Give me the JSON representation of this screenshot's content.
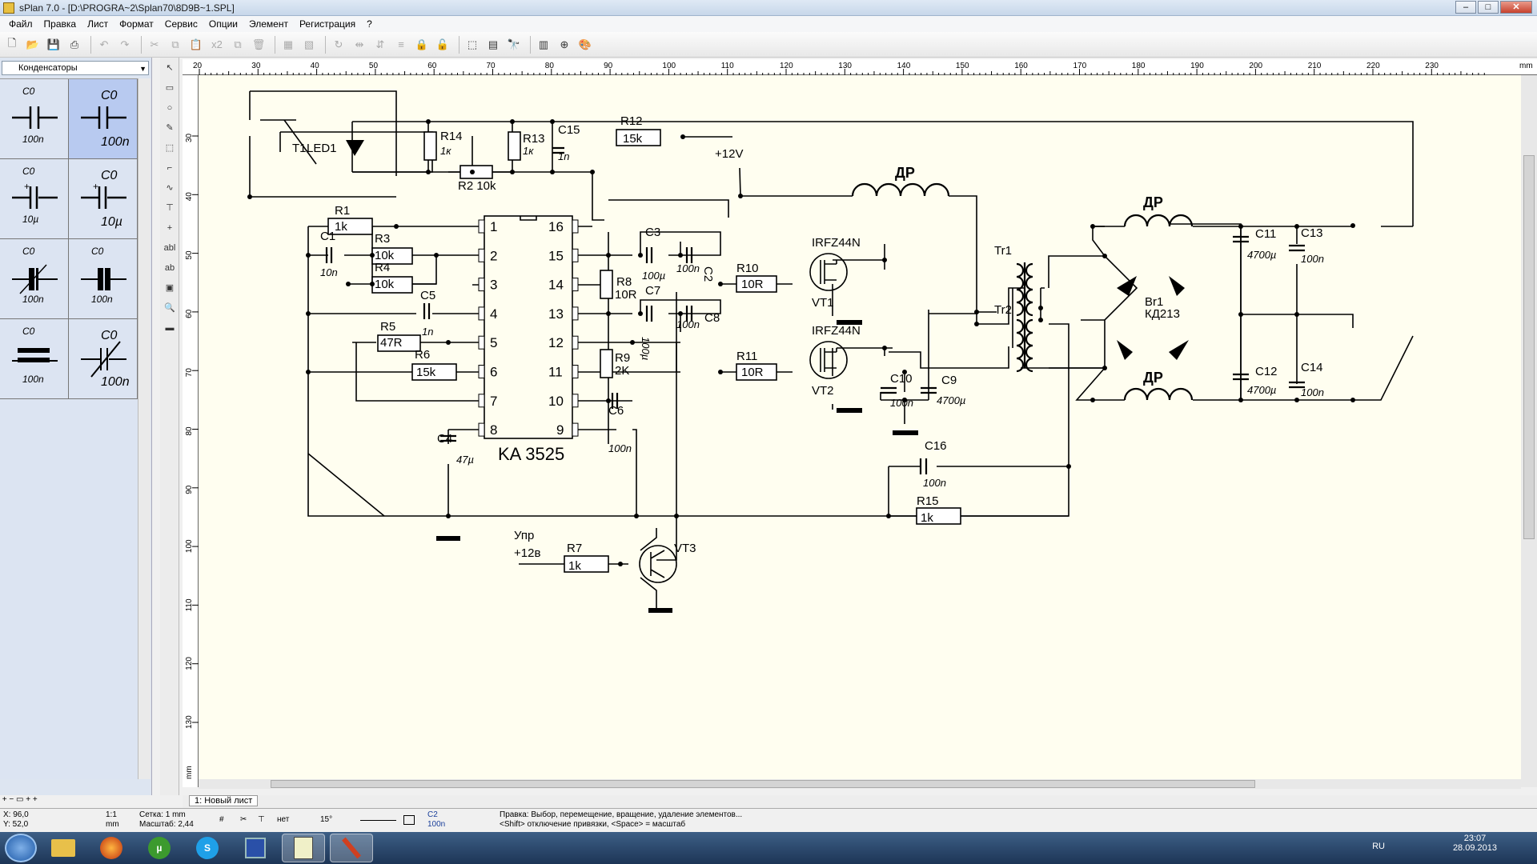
{
  "window": {
    "title": "sPlan 7.0 - [D:\\PROGRA~2\\Splan70\\8D9B~1.SPL]",
    "min": "–",
    "max": "□",
    "close": "✕"
  },
  "menu": [
    "Файл",
    "Правка",
    "Лист",
    "Формат",
    "Сервис",
    "Опции",
    "Элемент",
    "Регистрация",
    "?"
  ],
  "toolbar": {
    "icons": [
      "new-icon",
      "open-icon",
      "save-icon",
      "print-icon",
      "undo-icon",
      "redo-icon",
      "cut-icon",
      "copy-icon",
      "paste-icon",
      "duplicate-icon",
      "delete-icon",
      "group-icon",
      "ungroup-icon",
      "rotate-icon",
      "mirror-h-icon",
      "mirror-v-icon",
      "align-icon",
      "lock-icon",
      "unlock-icon",
      "select-net-icon",
      "pages-icon",
      "find-icon",
      "grid-icon",
      "zoom-icon",
      "colors-icon"
    ],
    "x2": "x2"
  },
  "library": {
    "selected": "Конденсаторы",
    "cells": [
      {
        "name": "C0",
        "value": "100n",
        "type": "cap"
      },
      {
        "name": "C0",
        "value": "100n",
        "type": "cap-big",
        "selected": true
      },
      {
        "name": "C0",
        "value": "10µ",
        "type": "elcap"
      },
      {
        "name": "C0",
        "value": "10µ",
        "type": "elcap-big"
      },
      {
        "name": "C0",
        "value": "100n",
        "type": "trim"
      },
      {
        "name": "C0",
        "value": "100n",
        "type": "varcap"
      },
      {
        "name": "C0",
        "value": "100n",
        "type": "cap-bold"
      },
      {
        "name": "C0",
        "value": "100n",
        "type": "varcap-big"
      }
    ]
  },
  "vtools": [
    "↖",
    "▭",
    "○",
    "✎",
    "⬚",
    "⌐",
    "∿",
    "⊤",
    "+",
    "abl",
    "ab",
    "▣",
    "🔍",
    "▬"
  ],
  "hruler": {
    "ticks": [
      "20",
      "30",
      "40",
      "50",
      "60",
      "70",
      "80",
      "90",
      "100",
      "110",
      "120",
      "130",
      "140",
      "150",
      "160",
      "170",
      "180",
      "190",
      "200",
      "210",
      "220",
      "230"
    ],
    "unit": "mm"
  },
  "vruler": {
    "ticks": [
      "30",
      "40",
      "50",
      "60",
      "70",
      "80",
      "90",
      "100",
      "110",
      "120",
      "130"
    ],
    "unit": "mm"
  },
  "schematic": {
    "chip": {
      "name": "KA 3525",
      "pins_left": [
        "1",
        "2",
        "3",
        "4",
        "5",
        "6",
        "7",
        "8"
      ],
      "pins_right": [
        "16",
        "15",
        "14",
        "13",
        "12",
        "11",
        "10",
        "9"
      ]
    },
    "labels": [
      {
        "t": "LED1"
      },
      {
        "t": "T1"
      },
      {
        "t": "R14"
      },
      {
        "t": "1к"
      },
      {
        "t": "R13"
      },
      {
        "t": "1к"
      },
      {
        "t": "C15"
      },
      {
        "t": "1n"
      },
      {
        "t": "R2 10k"
      },
      {
        "t": "R12"
      },
      {
        "t": "15k"
      },
      {
        "t": "+12V"
      },
      {
        "t": "ДР"
      },
      {
        "t": "ДР"
      },
      {
        "t": "ДР"
      },
      {
        "t": "R1"
      },
      {
        "t": "1k"
      },
      {
        "t": "C1"
      },
      {
        "t": "R3"
      },
      {
        "t": "10k"
      },
      {
        "t": "10n"
      },
      {
        "t": "R4"
      },
      {
        "t": "10k"
      },
      {
        "t": "C5"
      },
      {
        "t": "1n"
      },
      {
        "t": "R5"
      },
      {
        "t": "47R"
      },
      {
        "t": "R6"
      },
      {
        "t": "15k"
      },
      {
        "t": "C4"
      },
      {
        "t": "47µ"
      },
      {
        "t": "C3"
      },
      {
        "t": "100µ"
      },
      {
        "t": "C2"
      },
      {
        "t": "100n"
      },
      {
        "t": "R8"
      },
      {
        "t": "10R"
      },
      {
        "t": "C7"
      },
      {
        "t": "100µ"
      },
      {
        "t": "C8"
      },
      {
        "t": "100n"
      },
      {
        "t": "R9"
      },
      {
        "t": "2K"
      },
      {
        "t": "C6"
      },
      {
        "t": "100n"
      },
      {
        "t": "R10"
      },
      {
        "t": "10R"
      },
      {
        "t": "R11"
      },
      {
        "t": "10R"
      },
      {
        "t": "IRFZ44N"
      },
      {
        "t": "VT1"
      },
      {
        "t": "IRFZ44N"
      },
      {
        "t": "VT2"
      },
      {
        "t": "Tr1"
      },
      {
        "t": "Tr2"
      },
      {
        "t": "C10"
      },
      {
        "t": "100n"
      },
      {
        "t": "C9"
      },
      {
        "t": "4700µ"
      },
      {
        "t": "C16"
      },
      {
        "t": "100n"
      },
      {
        "t": "R15"
      },
      {
        "t": "1k"
      },
      {
        "t": "Вr1"
      },
      {
        "t": "КД213"
      },
      {
        "t": "C11"
      },
      {
        "t": "4700µ"
      },
      {
        "t": "C13"
      },
      {
        "t": "100n"
      },
      {
        "t": "C12"
      },
      {
        "t": "4700µ"
      },
      {
        "t": "C14"
      },
      {
        "t": "100n"
      },
      {
        "t": "Упр"
      },
      {
        "t": "+12в"
      },
      {
        "t": "R7"
      },
      {
        "t": "1k"
      },
      {
        "t": "VT3"
      }
    ]
  },
  "sheet": {
    "tab": "1: Новый лист"
  },
  "status": {
    "x": "X: 96,0",
    "y": "Y: 52,0",
    "scale_num": "1:1",
    "scale_unit": "mm",
    "grid": "Сетка: 1 mm",
    "zoom": "Масштаб:  2,44",
    "snap_none": "нет",
    "angle": "15°",
    "comp_name": "C2",
    "comp_val": "100n",
    "hint1": "Правка: Выбор, перемещение, вращение, удаление элементов...",
    "hint2": "<Shift> отключение привязки, <Space> = масштаб"
  },
  "taskbar": {
    "apps": [
      "start",
      "explorer",
      "firefox",
      "utorrent",
      "skype",
      "save-disk",
      "splan-doc",
      "splan-pen"
    ],
    "lang": "RU",
    "time": "23:07",
    "date": "28.09.2013"
  }
}
